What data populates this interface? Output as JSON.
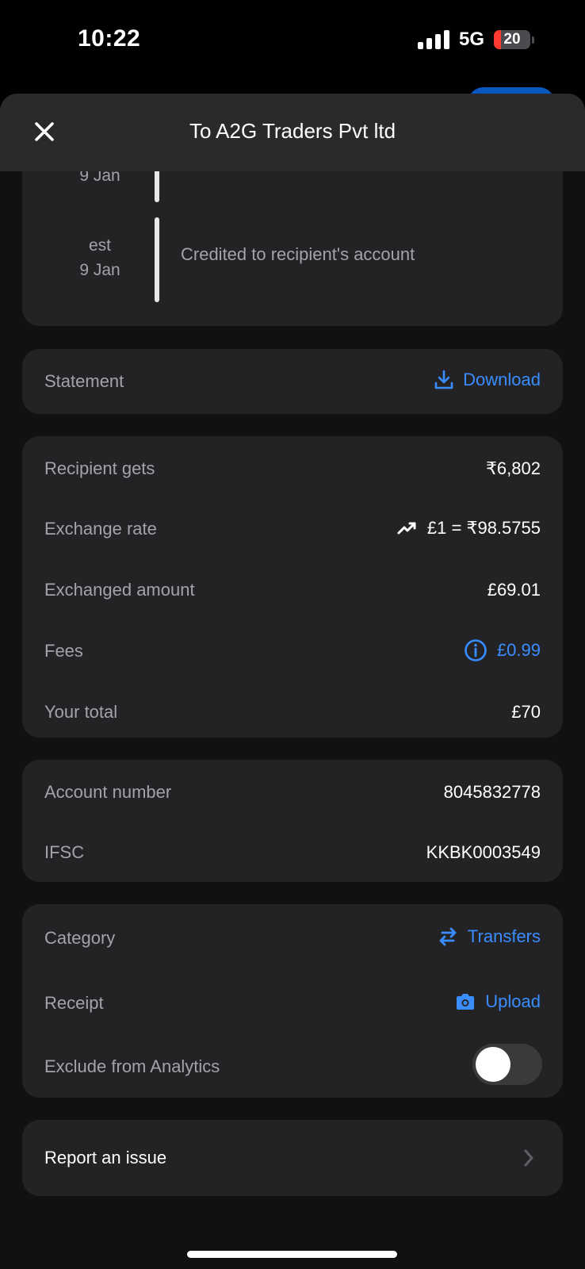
{
  "status_bar": {
    "time": "10:22",
    "network": "5G",
    "battery_percent": "20",
    "battery_level": 0.2,
    "battery_color": "#ff3b30"
  },
  "header": {
    "title": "To A2G Traders Pvt ltd",
    "close_icon": "close-icon"
  },
  "timeline": {
    "items": [
      {
        "date_top": "",
        "date_bottom": "9 Jan",
        "text": ""
      },
      {
        "date_top": "est",
        "date_bottom": "9 Jan",
        "text": "Credited to recipient's account"
      }
    ]
  },
  "statement": {
    "label": "Statement",
    "action_label": "Download",
    "action_icon": "download-icon"
  },
  "amounts": {
    "recipient_gets": {
      "label": "Recipient gets",
      "value": "₹6,802"
    },
    "exchange_rate": {
      "label": "Exchange rate",
      "value": "£1 = ₹98.5755",
      "icon": "trending-up-icon"
    },
    "exchanged_amount": {
      "label": "Exchanged amount",
      "value": "£69.01"
    },
    "fees": {
      "label": "Fees",
      "value": "£0.99",
      "icon": "info-icon"
    },
    "your_total": {
      "label": "Your total",
      "value": "£70"
    }
  },
  "bank_details": {
    "account_number": {
      "label": "Account number",
      "value": "8045832778"
    },
    "ifsc": {
      "label": "IFSC",
      "value": "KKBK0003549"
    }
  },
  "extras": {
    "category": {
      "label": "Category",
      "value": "Transfers",
      "icon": "transfer-arrows-icon"
    },
    "receipt": {
      "label": "Receipt",
      "value": "Upload",
      "icon": "camera-icon"
    },
    "exclude_analytics": {
      "label": "Exclude from Analytics",
      "enabled": false
    }
  },
  "report": {
    "label": "Report an issue",
    "icon": "chevron-right-icon"
  },
  "colors": {
    "accent_blue": "#3a8dff",
    "card_bg": "#232325",
    "header_bg": "#2a2a2c",
    "label_gray": "#a3a3a8"
  }
}
